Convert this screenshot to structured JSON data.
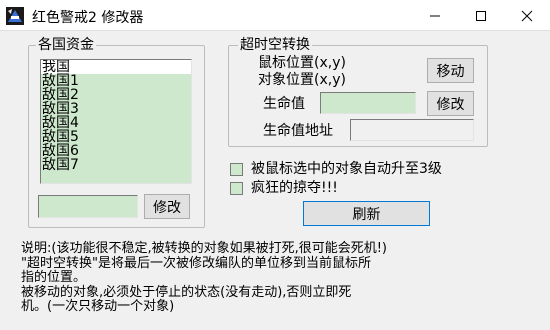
{
  "window": {
    "title": "红色警戒2 修改器"
  },
  "funds_group": {
    "label": "各国资金",
    "items": [
      "我国",
      "敌国1",
      "敌国2",
      "敌国3",
      "敌国4",
      "敌国5",
      "敌国6",
      "敌国7"
    ],
    "value": "",
    "modify_label": "修改"
  },
  "chrono_group": {
    "label": "超时空转换",
    "mouse_pos_label": "鼠标位置(x,y)",
    "object_pos_label": "对象位置(x,y)",
    "move_label": "移动",
    "hp_label": "生命值",
    "hp_value": "",
    "hp_modify_label": "修改",
    "hp_addr_label": "生命值地址",
    "hp_addr_value": ""
  },
  "options": {
    "auto_upgrade_label": "被鼠标选中的对象自动升至3级",
    "crazy_loot_label": "疯狂的掠夺!!!",
    "refresh_label": "刷新"
  },
  "description": {
    "line1": "说明:(该功能很不稳定,被转换的对象如果被打死,很可能会死机!)",
    "line2": "    \"超时空转换\"是将最后一次被修改编队的单位移到当前鼠标所",
    "line3": "指的位置。",
    "line4": "    被移动的对象,必须处于停止的状态(没有走动),否则立即死",
    "line5": "机。(一次只移动一个对象)"
  }
}
